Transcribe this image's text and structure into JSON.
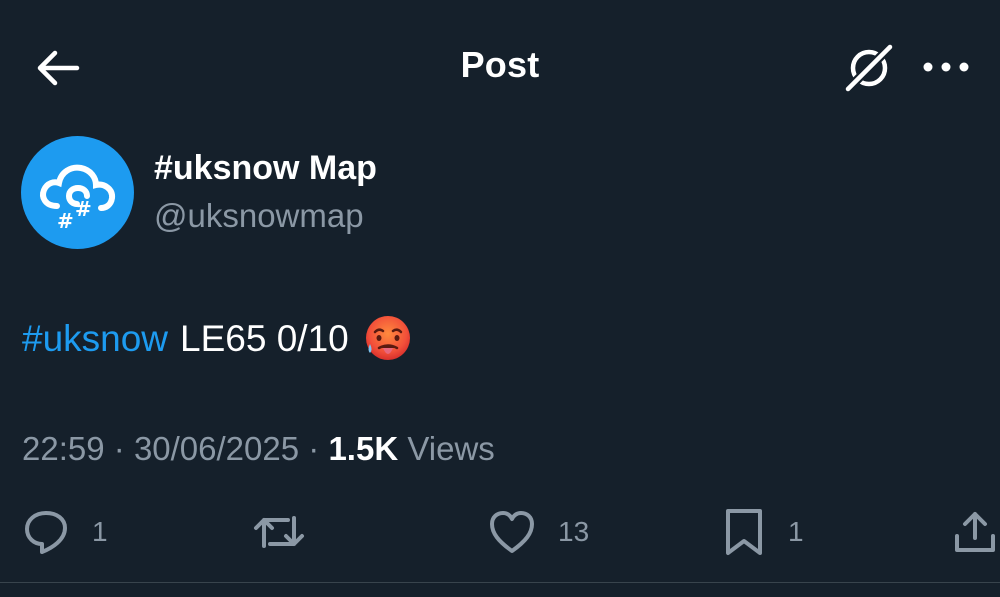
{
  "header": {
    "title": "Post",
    "back_icon": "arrow-left-icon",
    "grok_icon": "grok-icon",
    "more_icon": "more-horizontal-icon"
  },
  "author": {
    "display_name": "#uksnow Map",
    "handle": "@uksnowmap",
    "avatar_icon": "snow-cloud-hashtag-icon",
    "avatar_color": "#1d9bf0"
  },
  "tweet": {
    "hashtag": "#uksnow",
    "body": "LE65 0/10",
    "emoji": "hot-face-emoji",
    "hashtag_color": "#1d9bf0"
  },
  "meta": {
    "time": "22:59",
    "separator": "·",
    "date": "30/06/2025",
    "views_count": "1.5K",
    "views_label": "Views"
  },
  "actions": {
    "replies": "1",
    "reposts": "",
    "likes": "13",
    "bookmarks": "1"
  },
  "theme": {
    "background": "#15202b",
    "text": "#ffffff",
    "muted": "#8b98a5",
    "accent": "#1d9bf0"
  }
}
